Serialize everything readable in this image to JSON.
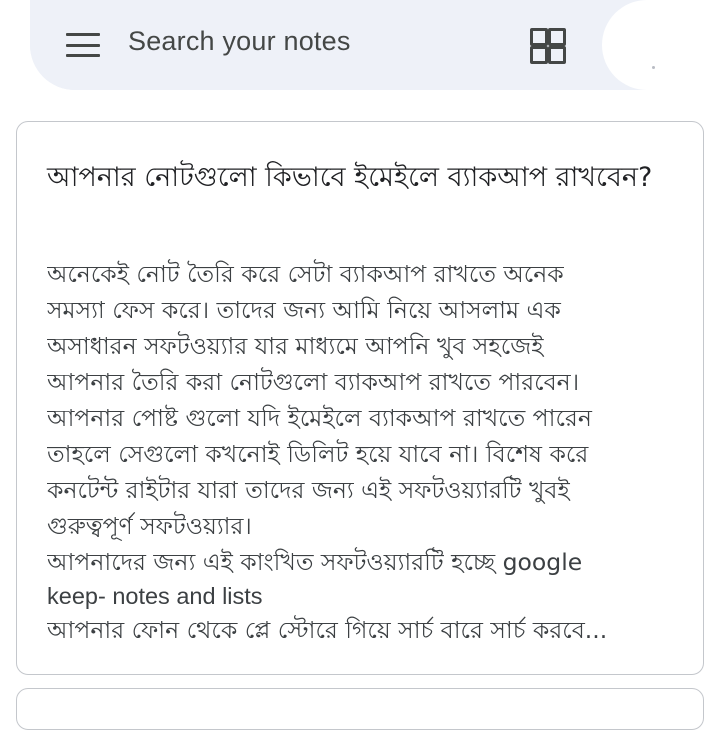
{
  "search": {
    "placeholder": "Search your notes",
    "menu_icon": "hamburger-menu-icon",
    "layout_icon": "grid-view-icon"
  },
  "note": {
    "title": "আপনার নোটগুলো কিভাবে ইমেইলে ব্যাকআপ রাখবেন?",
    "lines": [
      "অনেকেই নোট তৈরি করে সেটা ব্যাকআপ রাখতে অনেক",
      "সমস্যা ফেস করে। তাদের জন্য আমি নিয়ে আসলাম এক",
      "অসাধারন সফটওয়্যার যার মাধ্যমে আপনি খুব সহজেই",
      "আপনার তৈরি করা নোটগুলো ব্যাকআপ রাখতে পারবেন।",
      "আপনার পোষ্ট গুলো যদি ইমেইলে ব্যাকআপ রাখতে পারেন",
      "তাহলে সেগুলো কখনোই ডিলিট হয়ে যাবে না। বিশেষ করে",
      "কনটেন্ট রাইটার যারা তাদের জন্য এই সফটওয়্যারটি খুবই",
      "গুরুত্বপূর্ণ সফটওয়্যার।",
      "আপনাদের জন্য এই কাংখিত সফটওয়্যারটি হচ্ছে google",
      "keep- notes and lists",
      "আপনার ফোন থেকে প্লে স্টোরে গিয়ে সার্চ বারে সার্চ করবে..."
    ]
  },
  "colors": {
    "search_bg": "#eef1f8",
    "card_border": "#c4c7cc",
    "text": "#202124"
  }
}
